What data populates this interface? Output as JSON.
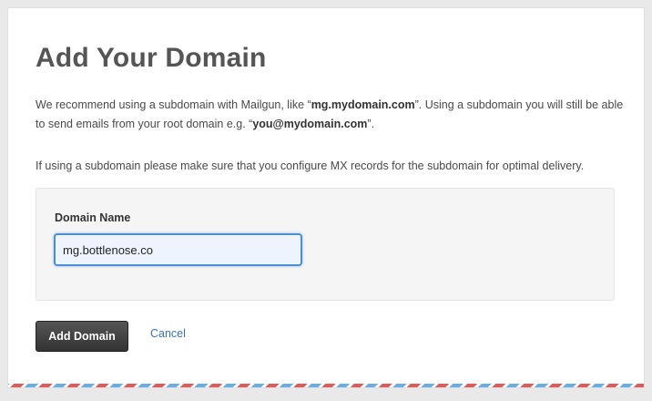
{
  "page": {
    "title": "Add Your Domain"
  },
  "intro": {
    "p1_before": "We recommend using a subdomain with Mailgun, like “",
    "p1_example_subdomain": "mg.mydomain.com",
    "p1_middle": "”. Using a subdomain you will still be able to send emails from your root domain e.g. “",
    "p1_example_email": "you@mydomain.com",
    "p1_after": "”.",
    "p2": "If using a subdomain please make sure that you configure MX records for the subdomain for optimal delivery."
  },
  "form": {
    "domain_label": "Domain Name",
    "domain_value": "mg.bottlenose.co"
  },
  "actions": {
    "submit_label": "Add Domain",
    "cancel_label": "Cancel"
  },
  "colors": {
    "input_focus_border": "#4a8fd6",
    "link": "#3a72b8",
    "button_bg": "#444444",
    "stripe_red": "#e25a5a",
    "stripe_blue": "#6aaee8"
  }
}
